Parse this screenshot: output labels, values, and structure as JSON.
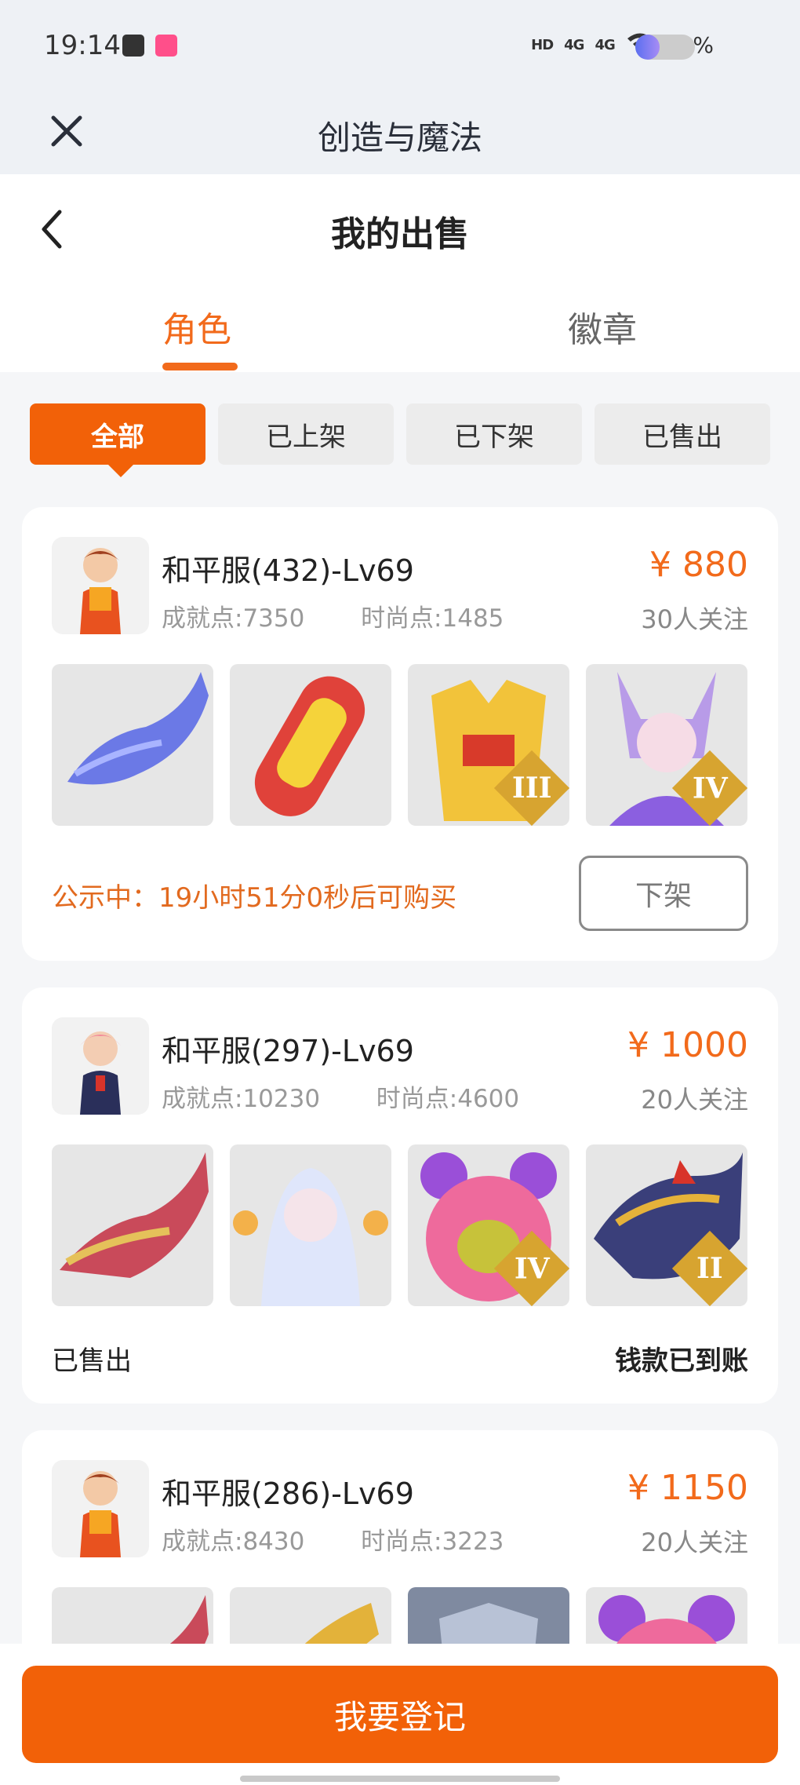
{
  "status": {
    "time": "19:14",
    "net1": "HD",
    "net2": "4G",
    "net3": "4G",
    "battery": "41%",
    "battery_level": 0.41
  },
  "appbar": {
    "title": "创造与魔法",
    "close_icon": "close-icon"
  },
  "page": {
    "title": "我的出售",
    "back_icon": "chevron-left-icon"
  },
  "tabs": [
    {
      "label": "角色",
      "active": true
    },
    {
      "label": "徽章",
      "active": false
    }
  ],
  "filters": [
    {
      "label": "全部",
      "active": true
    },
    {
      "label": "已上架"
    },
    {
      "label": "已下架"
    },
    {
      "label": "已售出"
    }
  ],
  "listings": [
    {
      "name": "和平服(432)-Lv69",
      "achievement": "成就点:7350",
      "fashion": "时尚点:1485",
      "price": "¥ 880",
      "followers": "30人关注",
      "item_grades": [
        "",
        "",
        "III",
        "IV"
      ],
      "notice": "公示中：19小时51分0秒后可购买",
      "button": "下架"
    },
    {
      "name": "和平服(297)-Lv69",
      "achievement": "成就点:10230",
      "fashion": "时尚点:4600",
      "price": "¥ 1000",
      "followers": "20人关注",
      "item_grades": [
        "",
        "",
        "IV",
        "II"
      ],
      "status": "已售出",
      "payment": "钱款已到账"
    },
    {
      "name": "和平服(286)-Lv69",
      "achievement": "成就点:8430",
      "fashion": "时尚点:3223",
      "price": "¥ 1150",
      "followers": "20人关注",
      "item_grades": [
        "",
        "",
        "",
        ""
      ]
    }
  ],
  "footer": {
    "register_label": "我要登记"
  },
  "colors": {
    "accent": "#f26108",
    "price": "#f26a1b",
    "notice": "#e26a1f"
  }
}
